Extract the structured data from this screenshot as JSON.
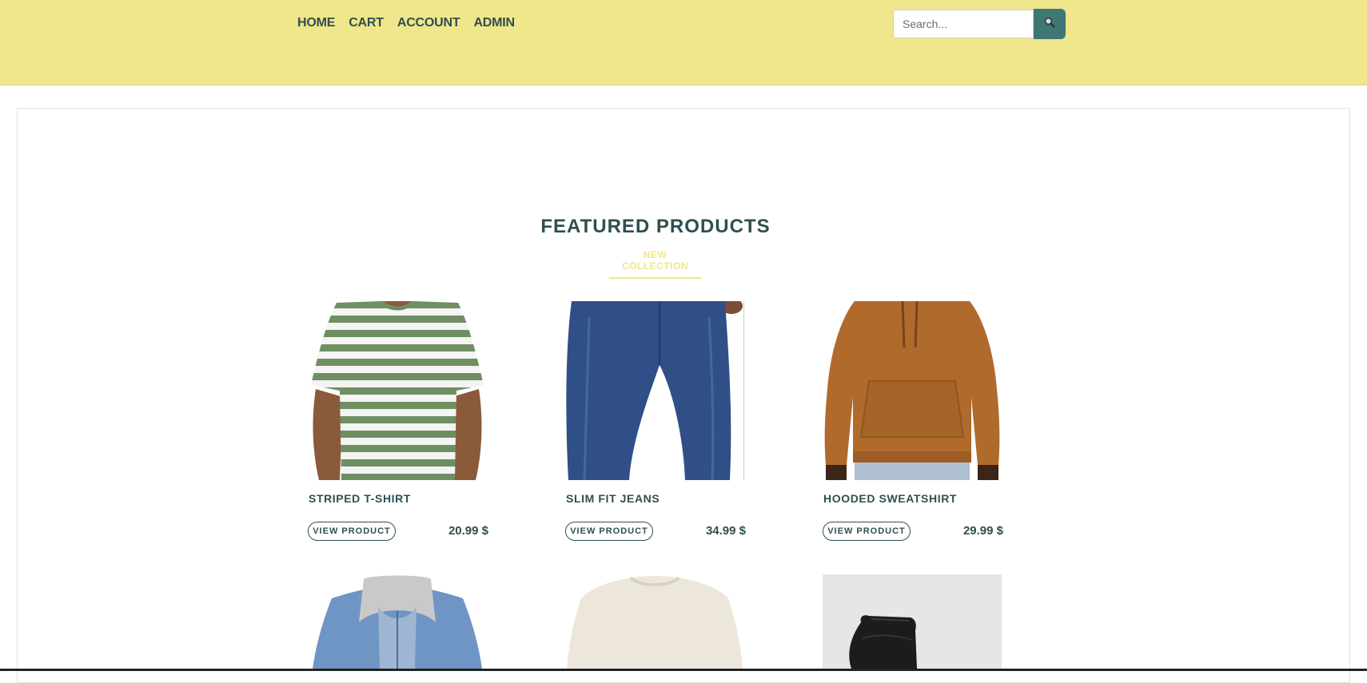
{
  "nav": {
    "items": [
      "HOME",
      "CART",
      "ACCOUNT",
      "ADMIN"
    ]
  },
  "search": {
    "placeholder": "Search..."
  },
  "section": {
    "title": "FEATURED PRODUCTS",
    "subtitle": "NEW COLLECTION"
  },
  "products": [
    {
      "name": "STRIPED T-SHIRT",
      "button": "VIEW PRODUCT",
      "price": "20.99 $"
    },
    {
      "name": "SLIM FIT JEANS",
      "button": "VIEW PRODUCT",
      "price": "34.99 $"
    },
    {
      "name": "HOODED SWEATSHIRT",
      "button": "VIEW PRODUCT",
      "price": "29.99 $"
    }
  ],
  "colors": {
    "header_bg": "#f0e68c",
    "primary_text": "#2f4f4f",
    "search_button": "#3f7774",
    "accent": "#f0e68c"
  },
  "icons": {
    "search": "search-icon"
  }
}
